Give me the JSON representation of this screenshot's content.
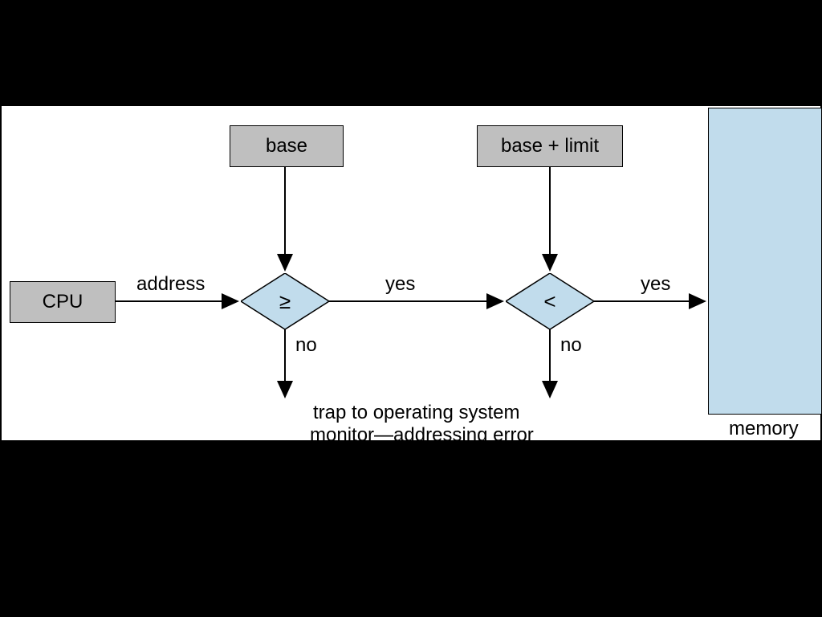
{
  "nodes": {
    "cpu": "CPU",
    "base": "base",
    "baselimit": "base + limit",
    "memory": "memory",
    "ge": "≥",
    "lt": "<"
  },
  "edges": {
    "address": "address",
    "yes1": "yes",
    "no1": "no",
    "yes2": "yes",
    "no2": "no"
  },
  "caption": {
    "line1": "trap to operating system",
    "line2": "monitor—addressing error"
  }
}
